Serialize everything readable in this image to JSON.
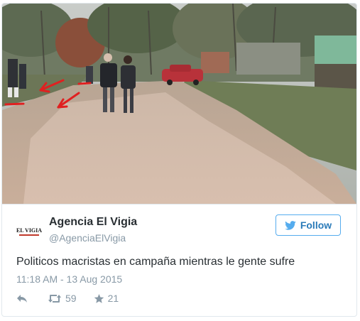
{
  "user": {
    "display_name": "Agencia El Vigia",
    "handle": "@AgenciaElVigia",
    "avatar_text": "EL VIGIA"
  },
  "follow_label": "Follow",
  "tweet": {
    "text": "Politicos macristas en campaña mientras le gente sufre",
    "timestamp": "11:18 AM - 13 Aug 2015"
  },
  "actions": {
    "reply_icon": "reply-icon",
    "retweet_icon": "retweet-icon",
    "retweet_count": "59",
    "favorite_icon": "star-icon",
    "favorite_count": "21"
  },
  "colors": {
    "accent": "#55acee",
    "follow_text": "#2b7bb9",
    "name": "#292f33",
    "muted": "#8899a6",
    "annotation_red": "#e02020"
  }
}
